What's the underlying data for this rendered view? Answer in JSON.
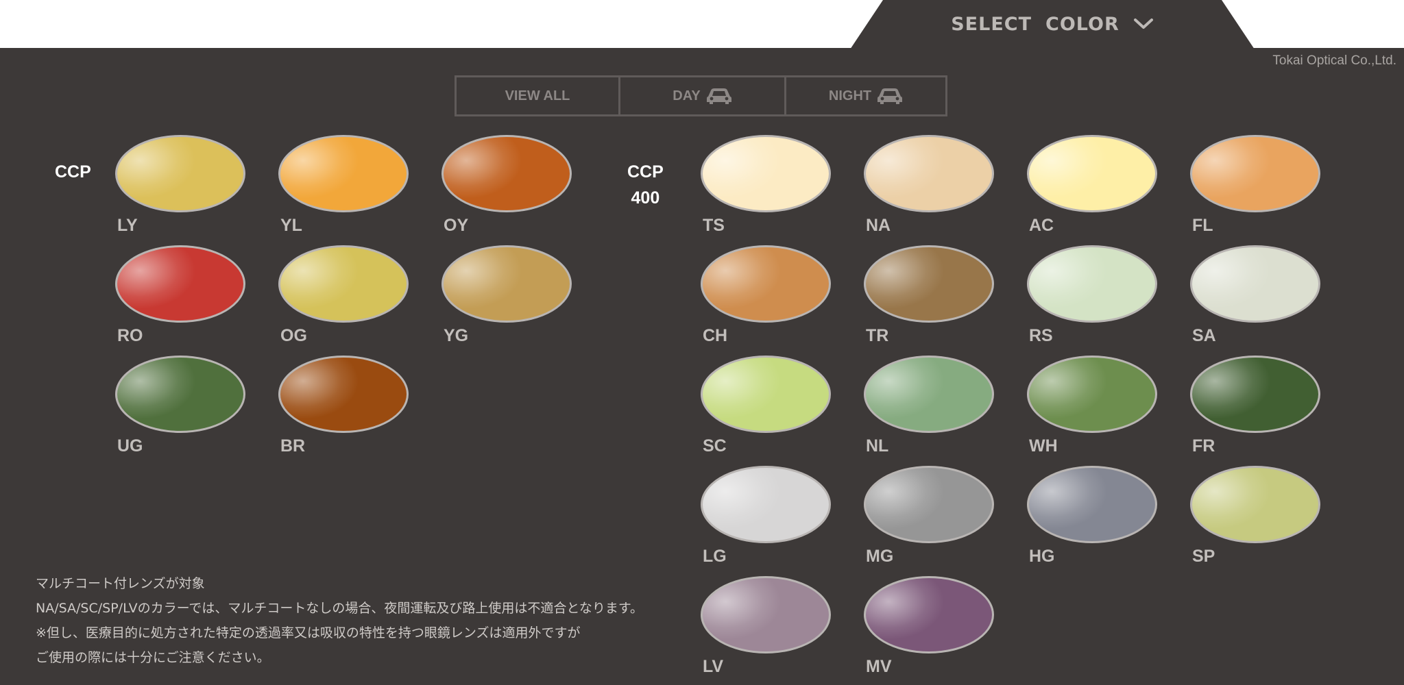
{
  "header": {
    "select_label": "SELECT",
    "color_label": "COLOR",
    "dropdown_icon": "chevron-down-icon",
    "company": "Tokai Optical Co.,Ltd."
  },
  "filters": [
    {
      "label": "VIEW ALL"
    },
    {
      "label": "DAY",
      "icon": "car-icon"
    },
    {
      "label": "NIGHT",
      "icon": "car-icon"
    }
  ],
  "groups": {
    "ccp": {
      "label": "CCP"
    },
    "ccp400": {
      "line1": "CCP",
      "line2": "400"
    }
  },
  "lenses": {
    "ccp": [
      {
        "code": "LY",
        "color": "#dcc05a"
      },
      {
        "code": "YL",
        "color": "#f2a73a"
      },
      {
        "code": "OY",
        "color": "#c05e1c"
      },
      {
        "code": "RO",
        "color": "#c83932"
      },
      {
        "code": "OG",
        "color": "#d5c25a"
      },
      {
        "code": "YG",
        "color": "#c39d55"
      },
      {
        "code": "UG",
        "color": "#50703d"
      },
      {
        "code": "BR",
        "color": "#9a4b10"
      }
    ],
    "ccp400": [
      {
        "code": "TS",
        "color": "#fcebc4"
      },
      {
        "code": "NA",
        "color": "#ecd0a7"
      },
      {
        "code": "AC",
        "color": "#feefa7"
      },
      {
        "code": "FL",
        "color": "#e9a45f"
      },
      {
        "code": "CH",
        "color": "#cf8d4e"
      },
      {
        "code": "TR",
        "color": "#98764a"
      },
      {
        "code": "RS",
        "color": "#d4e3c5"
      },
      {
        "code": "SA",
        "color": "#dcdfd0"
      },
      {
        "code": "SC",
        "color": "#c6db80"
      },
      {
        "code": "NL",
        "color": "#86ab80"
      },
      {
        "code": "WH",
        "color": "#6d8e4e"
      },
      {
        "code": "FR",
        "color": "#415f32"
      },
      {
        "code": "LG",
        "color": "#d7d6d6"
      },
      {
        "code": "MG",
        "color": "#969696"
      },
      {
        "code": "HG",
        "color": "#848793"
      },
      {
        "code": "SP",
        "color": "#c6ca80"
      },
      {
        "code": "LV",
        "color": "#9d8797"
      },
      {
        "code": "MV",
        "color": "#7b5778"
      }
    ]
  },
  "notes": [
    "マルチコート付レンズが対象",
    "NA/SA/SC/SP/LVのカラーでは、マルチコートなしの場合、夜間運転及び路上使用は不適合となります。",
    "※但し、医療目的に処方された特定の透過率又は吸収の特性を持つ眼鏡レンズは適用外ですが",
    "ご使用の際には十分にご注意ください。"
  ]
}
